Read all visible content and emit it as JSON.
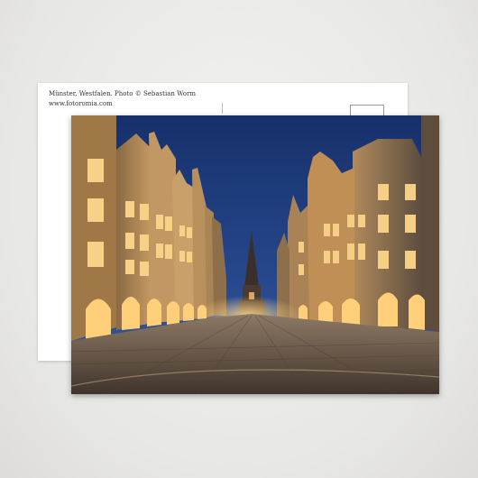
{
  "postcard": {
    "caption_line1": "Münster, Westfalen. Photo © Sebastian Worm",
    "caption_line2": "www.fotoromia.com"
  },
  "photo": {
    "subject": "Night street scene with gabled buildings, cobblestone road and church spire",
    "sky_color": "#1e3a78",
    "light_color": "#f1b85a",
    "cobble_color": "#6a5a4c"
  }
}
